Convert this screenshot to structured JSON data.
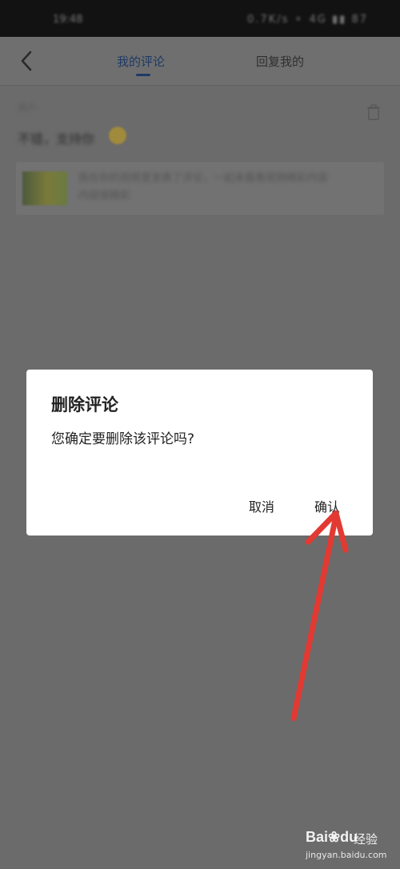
{
  "status_bar": {
    "time": "19:48",
    "icons": "0.7K/s ⚬ 4G ▮▮ 87"
  },
  "header": {
    "tabs": [
      {
        "label": "我的评论"
      },
      {
        "label": "回复我的"
      }
    ]
  },
  "comment": {
    "user": "用户",
    "text": "不错，支持你",
    "card_text": "我在你的视频里发表了评论，一起来看看视频精彩内容",
    "card_text2": "内容很精彩"
  },
  "dialog": {
    "title": "删除评论",
    "message": "您确定要删除该评论吗?",
    "cancel_label": "取消",
    "confirm_label": "确认"
  },
  "watermark": {
    "logo": "Bai",
    "logo_suffix": "du",
    "name": "经验",
    "url": "jingyan.baidu.com"
  },
  "colors": {
    "accent": "#1e3a66",
    "arrow": "#e23a32",
    "overlay": "#6b6b6b"
  }
}
